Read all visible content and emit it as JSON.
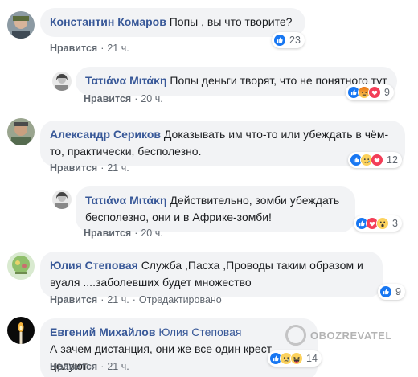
{
  "like_label": "Нравится",
  "comments": [
    {
      "author": "Константин Комаров",
      "text": "Попы , вы что творите?",
      "time": "21 ч.",
      "reaction_count": "23",
      "reactions": [
        "like-icon"
      ]
    },
    {
      "author": "Τατιάνα Μιτάκη",
      "text": "Попы деньги творят, что не понятного тут",
      "time": "20 ч.",
      "reaction_count": "9",
      "reactions": [
        "like-icon",
        "angry-icon",
        "heart-icon"
      ]
    },
    {
      "author": "Александр Сериков",
      "text": "Доказывать им что-то или убеждать в чём-то, практически, бесполезно.",
      "time": "21 ч.",
      "reaction_count": "12",
      "reactions": [
        "like-icon",
        "sad-icon",
        "heart-icon"
      ]
    },
    {
      "author": "Τατιάνα Μιτάκη",
      "text": "Действительно, зомби убеждать бесполезно, они и в Африке-зомби!",
      "time": "20 ч.",
      "reaction_count": "3",
      "reactions": [
        "like-icon",
        "heart-icon",
        "wow-icon"
      ]
    },
    {
      "author": "Юлия Степовая",
      "text": "Служба ,Пасха ,Проводы таким образом и вуаля ....заболевших будет множество",
      "time": "21 ч.",
      "edited": "Отредактировано",
      "reaction_count": "9",
      "reactions": [
        "like-icon"
      ]
    },
    {
      "author": "Евгений Михайлов",
      "mention": "Юлия Степовая",
      "text": "А зачем дистанция, они же все один крест целуют",
      "time": "21 ч.",
      "reaction_count": "14",
      "reactions": [
        "like-icon",
        "sad-icon",
        "haha-icon"
      ]
    }
  ],
  "watermark": "OBOZREVATEL",
  "colors": {
    "author": "#385898",
    "bubble": "#f2f3f5",
    "meta": "#606770",
    "like": "#1877f2",
    "heart": "#f33e58",
    "emoji": "#fcd25d"
  }
}
